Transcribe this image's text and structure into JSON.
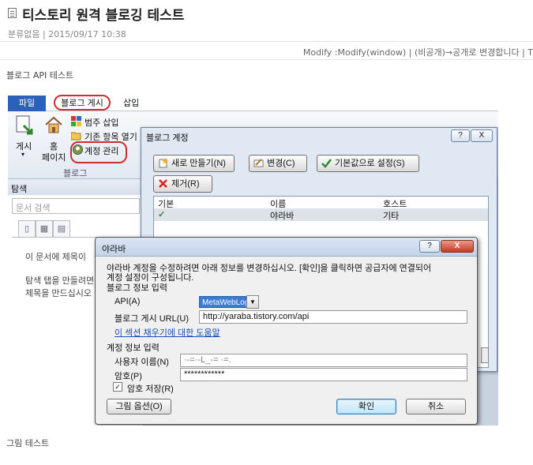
{
  "post": {
    "title": "티스토리 원격 블로깅 테스트",
    "meta": "분류없음 | 2015/09/17 10:38",
    "modify_line": "Modify :Modify(window) | (비공개)→공개로 변경합니다 | T",
    "intro": "블로그 API 테스트",
    "outro": "그림 테스트"
  },
  "ribbon": {
    "tabs": {
      "file": "파일",
      "blog": "블로그 게시",
      "insert": "삽입"
    },
    "publish": "게시",
    "home_1": "홈",
    "home_2": "페이지",
    "insert_category": "범주 삽입",
    "open_existing": "기존 항목 열기",
    "account_mgmt": "계정 관리",
    "group_label": "블로그"
  },
  "nav": {
    "header": "탐색",
    "search_placeholder": "문서 검색",
    "msg1": "이 문서에 제목이",
    "msg2": "탐색 탭을 만들려면",
    "msg3": "제목을 만드십시오"
  },
  "accounts_dialog": {
    "title": "블로그 계정",
    "help": "?",
    "close": "X",
    "new_button": "새로 만들기(N)",
    "change_button": "변경(C)",
    "default_button": "기본값으로 설정(S)",
    "remove_button": "제거(R)",
    "col_default": "기본",
    "col_name": "이름",
    "col_host": "호스트",
    "row": {
      "check": "✓",
      "name": "야라바",
      "host": "기타"
    }
  },
  "yaraba_dialog": {
    "title": "야라바",
    "help": "?",
    "close": "X",
    "desc_1": "야라바 계정을 수정하려면 아래 정보를 변경하십시오. [확인]을 클릭하면 공급자에 연결되어",
    "desc_2": "계정 설정이 구성됩니다.",
    "blog_section": "블로그 정보 입력",
    "api_label": "API(A)",
    "api_value": "MetaWebLog",
    "url_label": "블로그 게시 URL(U)",
    "url_value": "http://yaraba.tistory.com/api",
    "help_link": "이 섹션 채우기에 대한 도움말",
    "account_section": "계정 정보 입력",
    "username_label": "사용자 이름(N)",
    "username_value": "·-=·-L_-= ·=.",
    "password_label": "암호(P)",
    "password_value": "************",
    "remember_check": "✓",
    "remember_label": "암호 저장(R)",
    "picture_options": "그림 옵션(O)",
    "ok": "확인",
    "cancel": "취소"
  }
}
